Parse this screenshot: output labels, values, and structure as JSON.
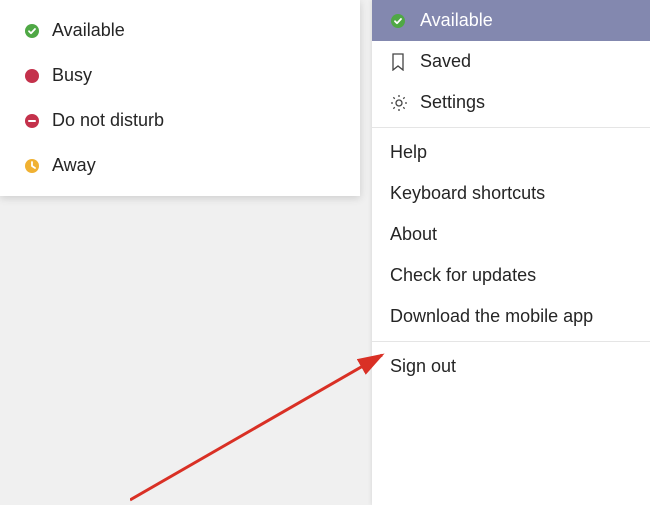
{
  "status_menu": {
    "items": [
      {
        "label": "Available",
        "icon": "available"
      },
      {
        "label": "Busy",
        "icon": "busy"
      },
      {
        "label": "Do not disturb",
        "icon": "dnd"
      },
      {
        "label": "Away",
        "icon": "away"
      }
    ]
  },
  "main_menu": {
    "selected_status_label": "Available",
    "saved_label": "Saved",
    "settings_label": "Settings",
    "help_label": "Help",
    "keyboard_shortcuts_label": "Keyboard shortcuts",
    "about_label": "About",
    "check_updates_label": "Check for updates",
    "download_app_label": "Download the mobile app",
    "sign_out_label": "Sign out"
  },
  "colors": {
    "available": "#4fa845",
    "busy": "#c4314b",
    "dnd": "#c4314b",
    "away": "#f0b132",
    "selected_bg": "#8388af"
  }
}
